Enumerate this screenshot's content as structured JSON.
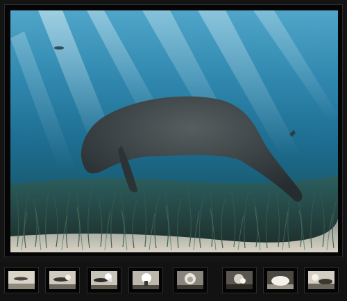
{
  "viewer": {
    "main_image": {
      "subject": "manatee-over-seagrass",
      "colors": {
        "water_top": "#4fa6c9",
        "water_mid": "#1d6d90",
        "seagrass": "#2c4a3a",
        "sand": "#c9c3b4",
        "manatee": "#3a4346"
      }
    },
    "thumbnails": [
      {
        "subject": "airship-sky",
        "selected": false
      },
      {
        "subject": "airship-smoke",
        "selected": false
      },
      {
        "subject": "airship-fire",
        "selected": false
      },
      {
        "subject": "explosion",
        "selected": false
      },
      {
        "subject": "explosion-smoke",
        "selected": false
      },
      {
        "subject": "burning-wreck",
        "selected": false
      },
      {
        "subject": "fireball-ground",
        "selected": false
      },
      {
        "subject": "wreck-crowd",
        "selected": false
      }
    ]
  }
}
